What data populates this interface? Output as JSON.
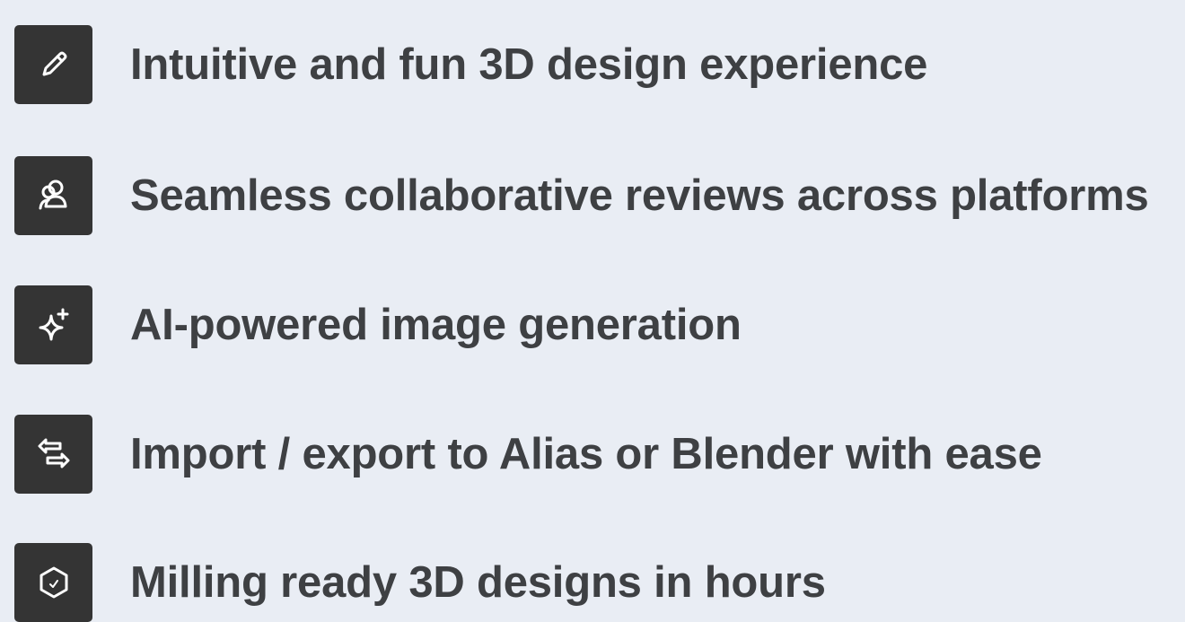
{
  "features": [
    {
      "icon": "pencil-icon",
      "label": "Intuitive and fun 3D design experience"
    },
    {
      "icon": "users-icon",
      "label": "Seamless collaborative reviews across platforms"
    },
    {
      "icon": "sparkle-icon",
      "label": "AI-powered image generation"
    },
    {
      "icon": "import-export-icon",
      "label": "Import / export to Alias or Blender with ease"
    },
    {
      "icon": "hexagon-check-icon",
      "label": "Milling ready 3D designs in hours"
    }
  ],
  "colors": {
    "background": "#e9edf4",
    "icon_tile": "#343434",
    "icon_glyph": "#ffffff",
    "text": "#3e4043"
  }
}
